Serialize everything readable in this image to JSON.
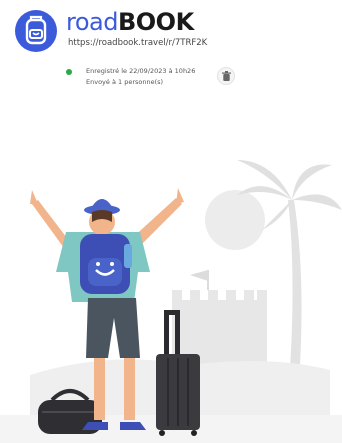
{
  "brand": {
    "name_part1": "road",
    "name_part2": "BOOK",
    "url": "https://roadbook.travel/r/7TRF2K"
  },
  "status": {
    "saved_text": "Enregistré le 22/09/2023 à 10h26",
    "sent_text": "Envoyé à 1 personne(s)",
    "dot_color": "#2aa84a"
  },
  "icons": [
    "backpack-logo-icon",
    "trash-icon"
  ],
  "colors": {
    "brand_blue": "#3b5bdb",
    "backpack_blue": "#3d4fb5"
  }
}
